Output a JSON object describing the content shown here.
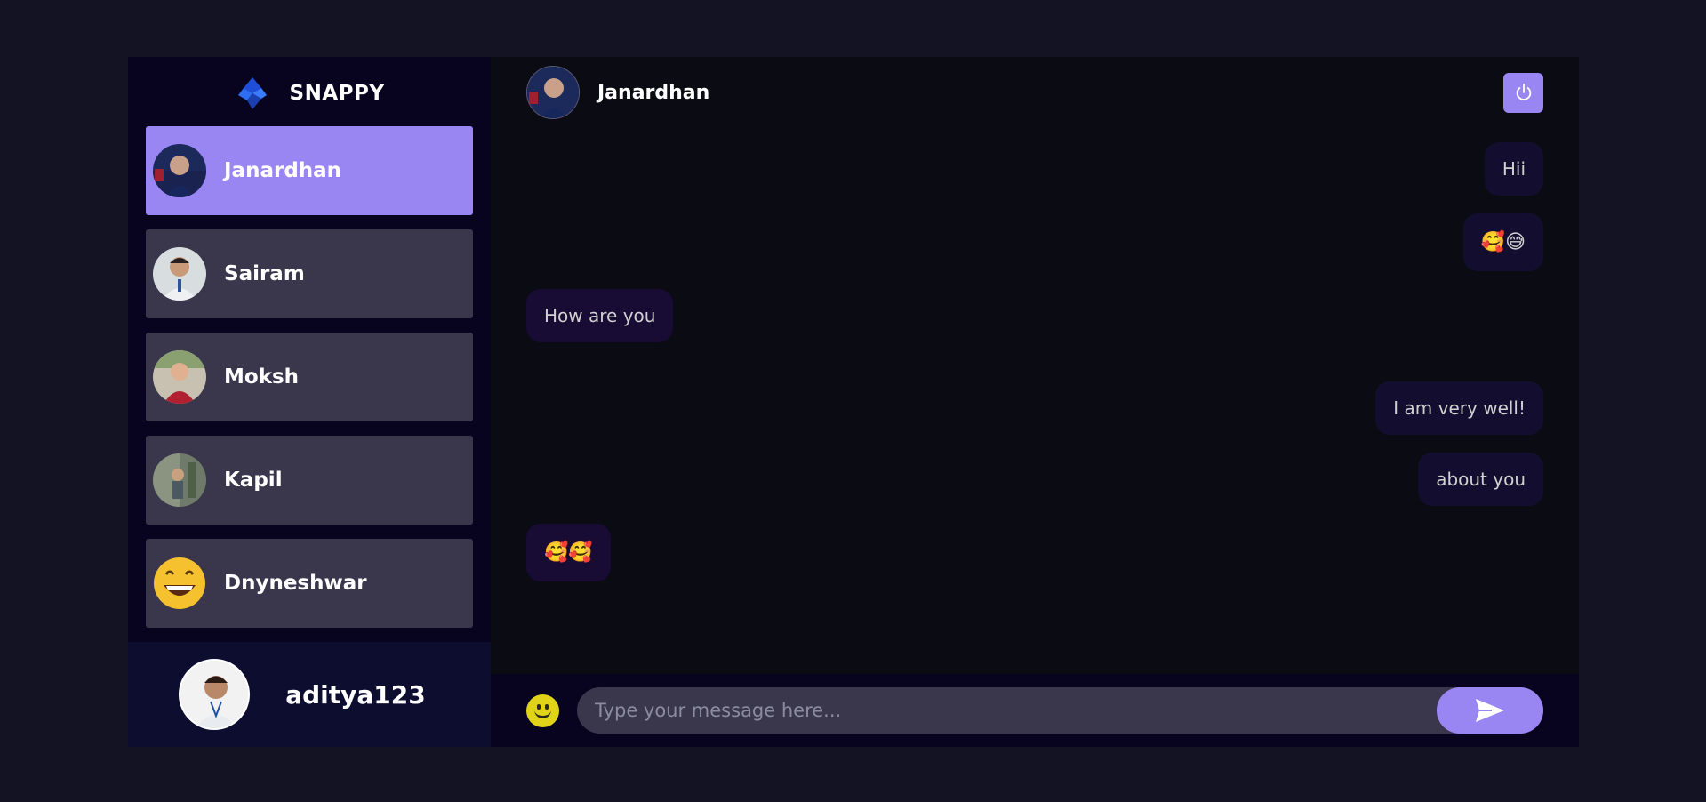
{
  "brand": {
    "name": "SNAPPY"
  },
  "contacts": [
    {
      "name": "Janardhan",
      "selected": true
    },
    {
      "name": "Sairam",
      "selected": false
    },
    {
      "name": "Moksh",
      "selected": false
    },
    {
      "name": "Kapil",
      "selected": false
    },
    {
      "name": "Dnyneshwar",
      "selected": false
    }
  ],
  "current_user": {
    "name": "aditya123"
  },
  "chat": {
    "header_name": "Janardhan",
    "messages": [
      {
        "direction": "sent",
        "text": "Hii"
      },
      {
        "direction": "sent",
        "text": "🥰😅"
      },
      {
        "direction": "received",
        "text": "How are you"
      },
      {
        "direction": "sent",
        "text": "I am very well!"
      },
      {
        "direction": "sent",
        "text": "about you"
      },
      {
        "direction": "received",
        "text": "🥰🥰"
      }
    ],
    "input_placeholder": "Type your message here..."
  },
  "colors": {
    "accent": "#9a86f3",
    "background": "#131324",
    "sidebar": "#080420",
    "contact_bg": "#3b3a4f"
  }
}
